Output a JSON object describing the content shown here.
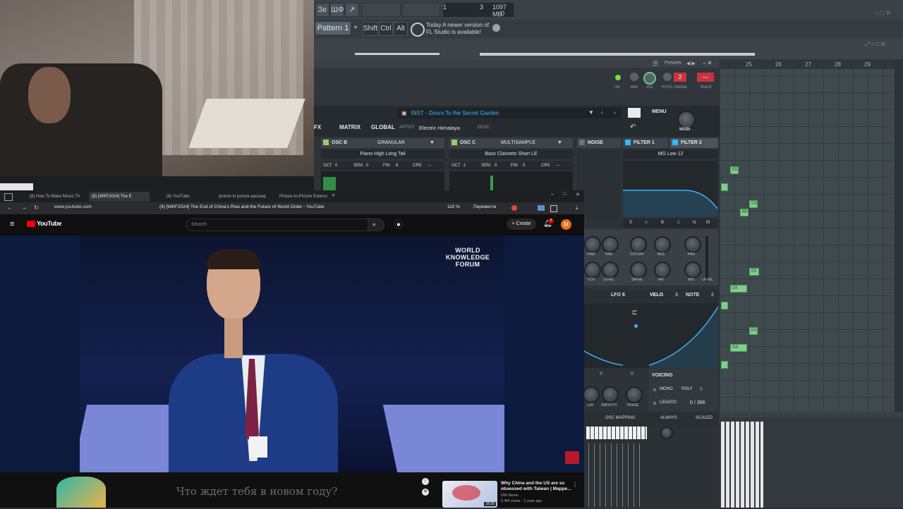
{
  "fl_studio": {
    "toolbar_icons": [
      "Зе",
      "ШФ",
      "↗"
    ],
    "cpu": {
      "value1": "1",
      "value2": "3",
      "value3": "0",
      "memory": "1097 MB"
    },
    "pattern_label": "Pattern 1",
    "add_symbol": "+",
    "shift_label": "Shift",
    "ctrl_label": "Ctrl",
    "alt_label": "Alt",
    "update_line1": "Today  A newer version of",
    "update_line2": "FL Studio is available!",
    "ruler_numbers": [
      "25",
      "26",
      "27",
      "28",
      "29"
    ],
    "notes": [
      "E5",
      "C6",
      "B5",
      "E5",
      "D5",
      "E4",
      "G4"
    ]
  },
  "serum": {
    "presets_label": "Presets",
    "mixer_labels": [
      "ON",
      "PAN",
      "VOL",
      "PITCH",
      "RANGE",
      "TRACK"
    ],
    "range_value": "2",
    "track_value": "---",
    "tabs": {
      "fx": "FX",
      "matrix": "MATRIX",
      "global": "GLOBAL"
    },
    "preset_name": "INST - Doors To the Secret Garden",
    "artist_label": "ARTIST:",
    "artist": "Electric Himalaya",
    "desc_label": "DESC:",
    "menu_label": "MENU",
    "main_label": "MAIN",
    "osc_b": {
      "name": "OSC B",
      "mode": "GRANULAR",
      "wavetable": "Piano High Long Tail",
      "oct": "0",
      "sem": "0",
      "fin": "6",
      "crs": "--"
    },
    "osc_c": {
      "name": "OSC C",
      "mode": "MULTISAMPLE",
      "wavetable": "Bass Clarinets Short LE",
      "oct": "-1",
      "sem": "0",
      "fin": "0",
      "crs": "--"
    },
    "param_labels": {
      "oct": "OCT",
      "sem": "SEM",
      "fin": "FIN",
      "crs": "CRS"
    },
    "noise_label": "NOISE",
    "filter1_label": "FILTER 1",
    "filter2_label": "FILTER 2",
    "filter_type": "MG Low 12",
    "filter_route": [
      "S",
      "A",
      "B",
      "C",
      "N"
    ],
    "knob_labels_row1": [
      "FINE",
      "PAN",
      "CUTOFF",
      "RES",
      "PAN"
    ],
    "knob_labels_row2": [
      "TCH",
      "LEVEL",
      "DRIVE",
      "FAT",
      "MIX",
      "LEVEL"
    ],
    "lfo_label": "LFO 6",
    "velo_label": "VELO",
    "velo_num": "3",
    "note_label": "NOTE",
    "note_num": "2",
    "voicing_label": "VOICING",
    "mono_label": "MONO",
    "poly_label": "POLY",
    "poly_value": "6",
    "legato_label": "LEGATO",
    "legato_value": "0 / 366",
    "lfo_knob_labels": [
      "LAY",
      "SMOOTH",
      "PHASE"
    ],
    "lfo_values": [
      "8",
      "8"
    ],
    "osc_mapping_label": "OSC MAPPING",
    "always_label": "ALWAYS",
    "scaled_label": "SCALED"
  },
  "browser": {
    "tabs": [
      "(8) How To Make Music Th",
      "(8) [WKF2024] The E",
      "(8) YouTube",
      "picture in picture расшир",
      "Picture-In-Picture Extensi"
    ],
    "new_tab": "+",
    "url": "www.youtube.com",
    "title": "(8) [WKF2024] The End of China's Rise and the Future of World Order - YouTube",
    "zoom": "110 %",
    "translate": "Перевести",
    "window_controls": [
      "–",
      "□",
      "✕"
    ]
  },
  "youtube": {
    "logo": "YouTube",
    "search_placeholder": "Search",
    "create_label": "Create",
    "notification_count": "9",
    "avatar_letter": "M",
    "watermark_lines": [
      "WORLD",
      "KNOWLEDGE",
      "FORUM"
    ],
    "banner_text": "Что ждет тебя в новом году?",
    "rec_title": "Why China and the US are so obsessed with Taiwan | Mappe...",
    "rec_channel": "DW News",
    "rec_views": "5.4M views · 1 year ago",
    "rec_duration": "16:30"
  },
  "colors": {
    "serum_accent": "#38b6ff",
    "yt_red": "#ff0000",
    "fl_note": "#7fcf8a"
  }
}
